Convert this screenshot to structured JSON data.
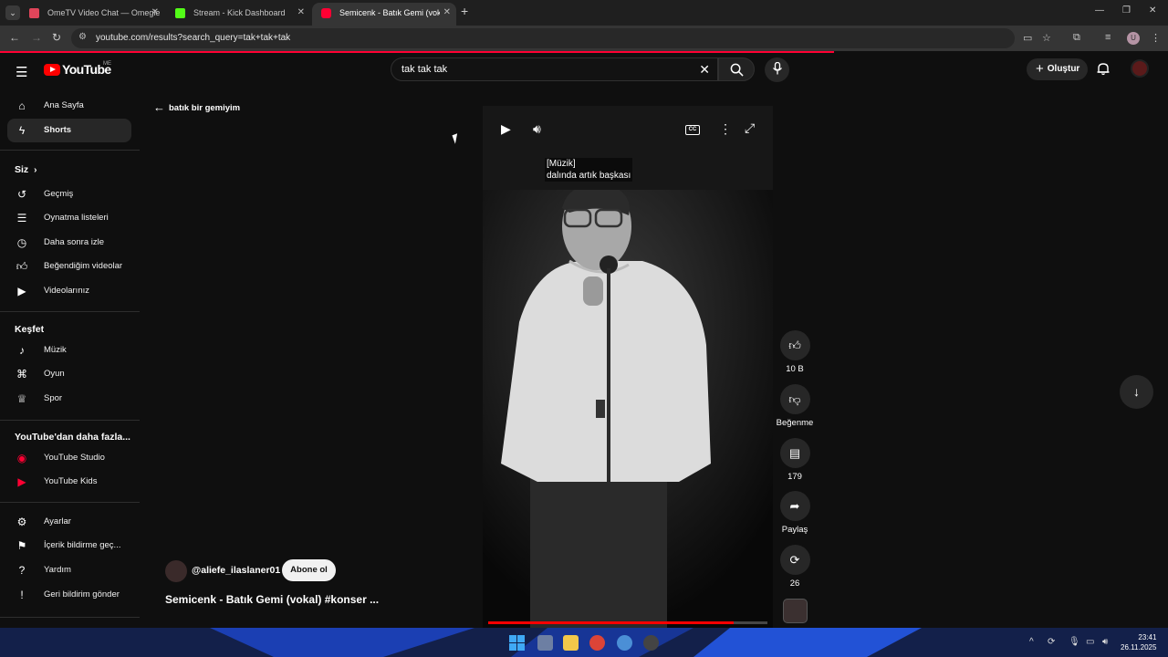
{
  "browser": {
    "tabs": [
      {
        "title": "OmeTV Video Chat — Omegle",
        "favicon_color": "#e0455a"
      },
      {
        "title": "Stream - Kick Dashboard",
        "favicon_color": "#53fc18"
      },
      {
        "title": "Semicenk - Batık Gemi (vokal) #k",
        "favicon_color": "#ff0033"
      }
    ],
    "url": "youtube.com/results?search_query=tak+tak+tak",
    "profile_letter": "U"
  },
  "masthead": {
    "logo_text": "YouTube",
    "region": "ME",
    "search_query": "tak tak tak",
    "create_label": "Oluştur"
  },
  "sidebar": {
    "top": [
      {
        "label": "Ana Sayfa",
        "icon": "home-icon"
      },
      {
        "label": "Shorts",
        "icon": "shorts-icon"
      }
    ],
    "you_heading": "Siz",
    "you": [
      {
        "label": "Geçmiş",
        "icon": "history-icon"
      },
      {
        "label": "Oynatma listeleri",
        "icon": "playlist-icon"
      },
      {
        "label": "Daha sonra izle",
        "icon": "clock-icon"
      },
      {
        "label": "Beğendiğim videolar",
        "icon": "thumbs-up-icon"
      },
      {
        "label": "Videolarınız",
        "icon": "your-videos-icon"
      }
    ],
    "explore_heading": "Keşfet",
    "explore": [
      {
        "label": "Müzik",
        "icon": "music-icon"
      },
      {
        "label": "Oyun",
        "icon": "gaming-icon"
      },
      {
        "label": "Spor",
        "icon": "trophy-icon"
      }
    ],
    "more_heading": "YouTube'dan daha fazla...",
    "more": [
      {
        "label": "YouTube Studio",
        "icon": "studio-icon"
      },
      {
        "label": "YouTube Kids",
        "icon": "kids-icon"
      }
    ],
    "bottom": [
      {
        "label": "Ayarlar",
        "icon": "settings-icon"
      },
      {
        "label": "İçerik bildirme geç...",
        "icon": "flag-icon"
      },
      {
        "label": "Yardım",
        "icon": "help-icon"
      },
      {
        "label": "Geri bildirim gönder",
        "icon": "feedback-icon"
      }
    ]
  },
  "back_link": "batık bir gemiyim",
  "player": {
    "caption_line1": "[Müzik]",
    "caption_line2": "dalında artık başkası",
    "progress": 0.88
  },
  "channel": {
    "handle": "@aliefe_ilaslaner01",
    "subscribe_label": "Abone ol"
  },
  "video_title": "Semicenk - Batık Gemi (vokal) #konser ...",
  "actions": [
    {
      "label": "10 B",
      "icon": "like-icon"
    },
    {
      "label": "Beğenme",
      "icon": "dislike-icon"
    },
    {
      "label": "179",
      "icon": "comment-icon"
    },
    {
      "label": "Paylaş",
      "icon": "share-icon"
    },
    {
      "label": "26",
      "icon": "remix-icon"
    }
  ],
  "taskbar": {
    "time": "23:41",
    "date": "26.11.2025"
  }
}
